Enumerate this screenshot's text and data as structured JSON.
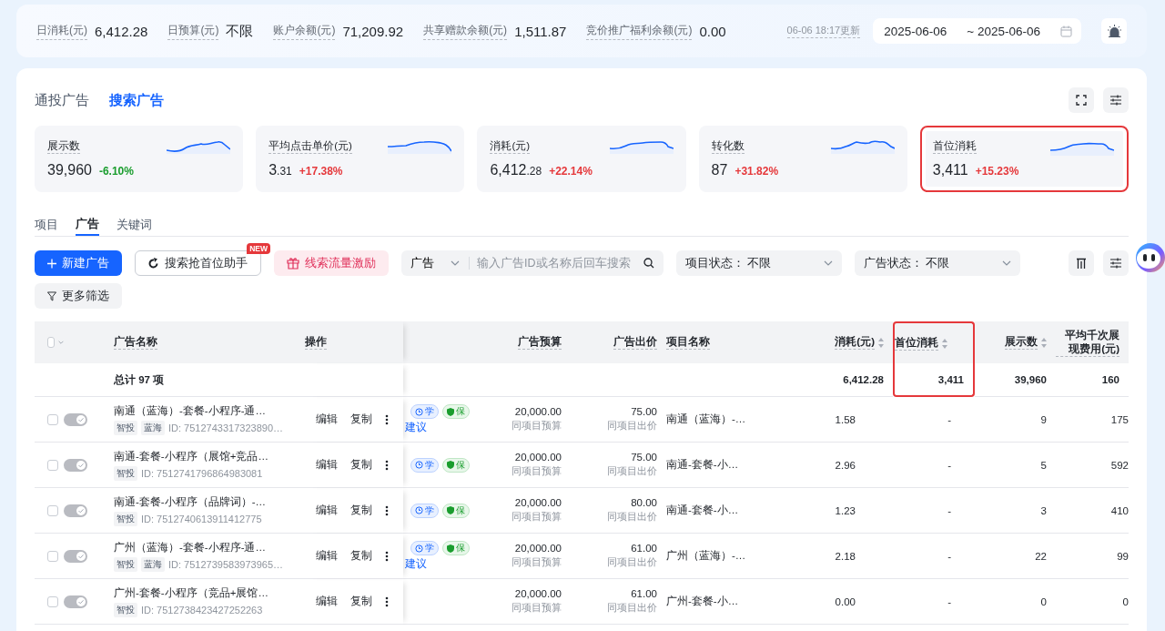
{
  "top_bar": {
    "stats": [
      {
        "label": "日消耗(元)",
        "value": "6,412.28"
      },
      {
        "label": "日预算(元)",
        "value": "不限"
      },
      {
        "label": "账户余额(元)",
        "value": "71,209.92"
      },
      {
        "label": "共享赠款余额(元)",
        "value": "1,511.87"
      },
      {
        "label": "竞价推广福利余额(元)",
        "value": "0.00"
      }
    ],
    "updated": "06-06 18:17更新",
    "date_start": "2025-06-06",
    "date_end": "~ 2025-06-06"
  },
  "ad_type_tabs": [
    {
      "label": "通投广告",
      "selected": false
    },
    {
      "label": "搜索广告",
      "selected": true
    }
  ],
  "metric_cards": [
    {
      "label": "展示数",
      "value": "39,960",
      "change": "-6.10%",
      "color": "#1a9d2e",
      "highlighted": false
    },
    {
      "label": "平均点击单价(元)",
      "value": "3",
      "decimal": ".31",
      "change": "+17.38%",
      "color": "#e5383b",
      "highlighted": false
    },
    {
      "label": "消耗(元)",
      "value": "6,412",
      "decimal": ".28",
      "change": "+22.14%",
      "color": "#e5383b",
      "highlighted": false
    },
    {
      "label": "转化数",
      "value": "87",
      "change": "+31.82%",
      "color": "#e5383b",
      "highlighted": false
    },
    {
      "label": "首位消耗",
      "value": "3,411",
      "change": "+15.23%",
      "color": "#e5383b",
      "highlighted": true
    }
  ],
  "level_tabs": [
    {
      "label": "项目",
      "selected": false
    },
    {
      "label": "广告",
      "selected": true
    },
    {
      "label": "关键词",
      "selected": false
    }
  ],
  "toolbar": {
    "new_button": "新建广告",
    "assistant_button": "搜索抢首位助手",
    "assistant_badge": "NEW",
    "incentive_button": "线索流量激励",
    "search_scope": "广告",
    "search_placeholder": "输入广告ID或名称后回车搜索",
    "filters": [
      {
        "label": "项目状态：",
        "value": "不限"
      },
      {
        "label": "广告状态：",
        "value": "不限"
      }
    ],
    "more_filters": "更多筛选"
  },
  "table": {
    "select_all_checked": false,
    "columns": [
      {
        "label": "广告名称",
        "sortable": false,
        "highlighted": false
      },
      {
        "label": "操作",
        "sortable": false,
        "highlighted": false
      },
      {
        "label": "广告预算",
        "sortable": false,
        "highlighted": false
      },
      {
        "label": "广告出价",
        "sortable": false,
        "highlighted": false
      },
      {
        "label": "项目名称",
        "sortable": false,
        "highlighted": false
      },
      {
        "label": "消耗(元)",
        "sortable": true,
        "highlighted": false
      },
      {
        "label": "首位消耗",
        "sortable": true,
        "highlighted": true
      },
      {
        "label": "展示数",
        "sortable": true,
        "highlighted": false
      },
      {
        "label": "平均千次展现费用(元)",
        "sortable": false,
        "highlighted": false
      }
    ],
    "total": {
      "label": "总计 97 项",
      "spend": "6,412.28",
      "first_spend": "3,411",
      "impressions": "39,960",
      "cpm": "160"
    },
    "rows": [
      {
        "checked": false,
        "on": true,
        "name": "南通（蓝海）-套餐-小程序-通…",
        "tags": [
          "智投",
          "蓝海"
        ],
        "id": "ID: 7512743317323890…",
        "actions": [
          "编辑",
          "复制"
        ],
        "status_tags": [
          "学",
          "保"
        ],
        "link": "建议",
        "budget": "20,000.00",
        "budget_note": "同项目预算",
        "bid": "75.00",
        "bid_note": "同项目出价",
        "project": "南通（蓝海）-…",
        "spend": "1.58",
        "first_spend": "-",
        "impressions": "9",
        "cpm": "175"
      },
      {
        "checked": false,
        "on": true,
        "name": "南通-套餐-小程序（展馆+竞品…",
        "tags": [
          "智投"
        ],
        "id": "ID: 7512741796864983081",
        "actions": [
          "编辑",
          "复制"
        ],
        "status_tags": [
          "学",
          "保"
        ],
        "budget": "20,000.00",
        "budget_note": "同项目预算",
        "bid": "75.00",
        "bid_note": "同项目出价",
        "project": "南通-套餐-小…",
        "spend": "2.96",
        "first_spend": "-",
        "impressions": "5",
        "cpm": "592"
      },
      {
        "checked": false,
        "on": true,
        "name": "南通-套餐-小程序（品牌词）-…",
        "tags": [
          "智投"
        ],
        "id": "ID: 7512740613911412775",
        "actions": [
          "编辑",
          "复制"
        ],
        "status_tags": [
          "学",
          "保"
        ],
        "budget": "20,000.00",
        "budget_note": "同项目预算",
        "bid": "80.00",
        "bid_note": "同项目出价",
        "project": "南通-套餐-小…",
        "spend": "1.23",
        "first_spend": "-",
        "impressions": "3",
        "cpm": "410"
      },
      {
        "checked": false,
        "on": true,
        "name": "广州（蓝海）-套餐-小程序-通…",
        "tags": [
          "智投",
          "蓝海"
        ],
        "id": "ID: 7512739583973965…",
        "actions": [
          "编辑",
          "复制"
        ],
        "status_tags": [
          "学",
          "保"
        ],
        "link": "建议",
        "budget": "20,000.00",
        "budget_note": "同项目预算",
        "bid": "61.00",
        "bid_note": "同项目出价",
        "project": "广州（蓝海）-…",
        "spend": "2.18",
        "first_spend": "-",
        "impressions": "22",
        "cpm": "99"
      },
      {
        "checked": false,
        "on": true,
        "name": "广州-套餐-小程序（竞品+展馆…",
        "tags": [
          "智投"
        ],
        "id": "ID: 7512738423427252263",
        "actions": [
          "编辑",
          "复制"
        ],
        "budget": "20,000.00",
        "budget_note": "同项目预算",
        "bid": "61.00",
        "bid_note": "同项目出价",
        "project": "广州-套餐-小…",
        "spend": "0.00",
        "first_spend": "-",
        "impressions": "0",
        "cpm": "0"
      }
    ]
  }
}
